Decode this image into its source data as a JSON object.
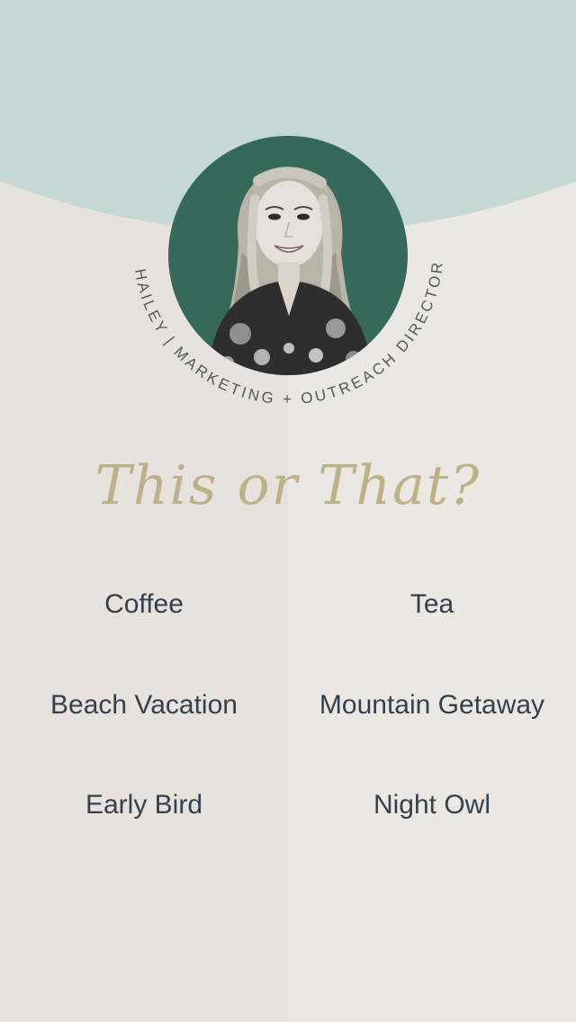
{
  "header": {
    "person_caption": "HAILEY | MARKETING + OUTREACH DIRECTOR"
  },
  "title": "This or That?",
  "options": [
    {
      "this": "Coffee",
      "that": "Tea"
    },
    {
      "this": "Beach Vacation",
      "that": "Mountain Getaway"
    },
    {
      "this": "Early Bird",
      "that": "Night Owl"
    }
  ],
  "colors": {
    "mint": "#c6d8d4",
    "beige": "#e7e2dd",
    "portrait_bg": "#356a5a",
    "title_gold": "#bdb287",
    "text_navy": "#34404c"
  }
}
